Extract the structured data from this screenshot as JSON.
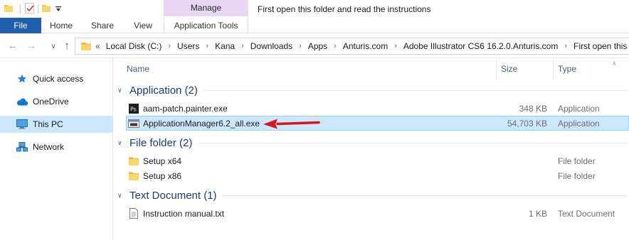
{
  "window": {
    "title": "First open this folder and read the instructions",
    "context_tab": "Manage"
  },
  "ribbon": {
    "tabs": [
      "File",
      "Home",
      "Share",
      "View",
      "Application Tools"
    ]
  },
  "address": {
    "lead": "«",
    "crumbs": [
      "Local Disk (C:)",
      "Users",
      "Kana",
      "Downloads",
      "Apps",
      "Anturis.com",
      "Adobe Illustrator CS6 16.2.0.Anturis.com",
      "First open this fo"
    ]
  },
  "sidebar": {
    "items": [
      {
        "label": "Quick access",
        "icon": "star-icon"
      },
      {
        "label": "OneDrive",
        "icon": "cloud-icon"
      },
      {
        "label": "This PC",
        "icon": "computer-icon"
      },
      {
        "label": "Network",
        "icon": "network-icon"
      }
    ],
    "selected": "This PC"
  },
  "columns": {
    "name": "Name",
    "size": "Size",
    "type": "Type"
  },
  "groups": [
    {
      "label": "Application (2)",
      "files": [
        {
          "name": "aam-patch.painter.exe",
          "size": "348 KB",
          "type": "Application",
          "icon": "patch-exe-icon"
        },
        {
          "name": "ApplicationManager6.2_all.exe",
          "size": "54,703 KB",
          "type": "Application",
          "icon": "app-manager-exe-icon"
        }
      ]
    },
    {
      "label": "File folder (2)",
      "files": [
        {
          "name": "Setup x64",
          "size": "",
          "type": "File folder",
          "icon": "folder-icon"
        },
        {
          "name": "Setup x86",
          "size": "",
          "type": "File folder",
          "icon": "folder-icon"
        }
      ]
    },
    {
      "label": "Text Document (1)",
      "files": [
        {
          "name": "Instruction manual.txt",
          "size": "1 KB",
          "type": "Text Document",
          "icon": "text-file-icon"
        }
      ]
    }
  ],
  "colors": {
    "file_tab": "#1f5fae",
    "manage_tab": "#e8d6f4",
    "selection": "#cce8ff",
    "group_label": "#1e3a70",
    "annotation_arrow": "#d9141b"
  }
}
